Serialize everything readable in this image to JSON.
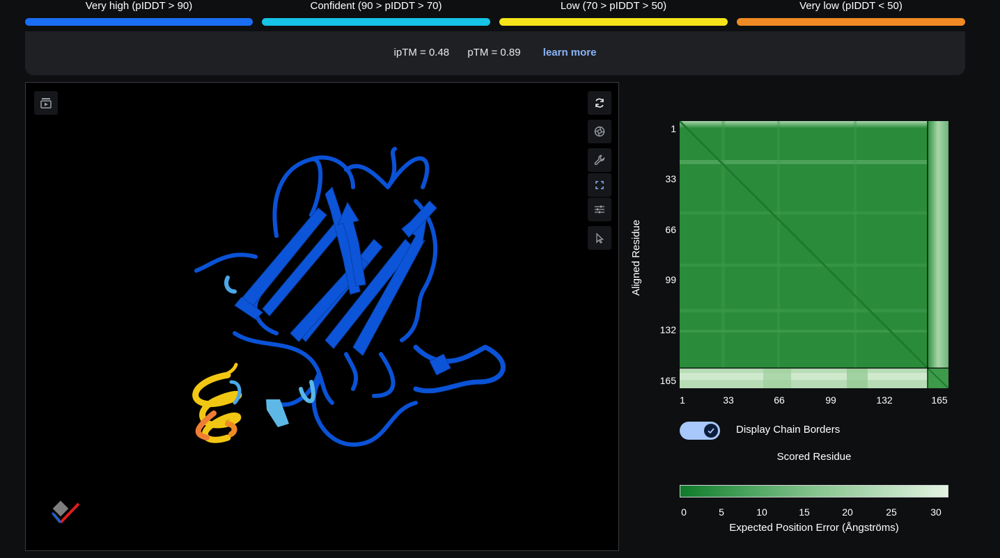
{
  "legend": [
    {
      "label": "Very high (pIDDT > 90)",
      "color": "#1a6ef5"
    },
    {
      "label": "Confident (90 > pIDDT > 70)",
      "color": "#15c4e6"
    },
    {
      "label": "Low (70 > pIDDT > 50)",
      "color": "#f5e41a"
    },
    {
      "label": "Very low (pIDDT < 50)",
      "color": "#f08a24"
    }
  ],
  "metrics": {
    "iptm": "ipTM = 0.48",
    "ptm": "pTM = 0.89",
    "learn_more": "learn more"
  },
  "viewer": {
    "tools": [
      "sequence-view-icon",
      "rotate-icon",
      "camera-icon",
      "wrench-icon",
      "fullscreen-icon",
      "sliders-icon",
      "cursor-icon"
    ]
  },
  "pae": {
    "ylabel": "Aligned Residue",
    "yticks": [
      "1",
      "33",
      "66",
      "99",
      "132",
      "165"
    ],
    "xticks": [
      "1",
      "33",
      "66",
      "99",
      "132",
      "165"
    ],
    "toggle_label": "Display Chain Borders",
    "toggle_on": true,
    "scored_label": "Scored Residue",
    "colorbar_ticks": [
      "0",
      "5",
      "10",
      "15",
      "20",
      "25",
      "30"
    ],
    "colorbar_title": "Expected Position Error (Ångströms)"
  }
}
